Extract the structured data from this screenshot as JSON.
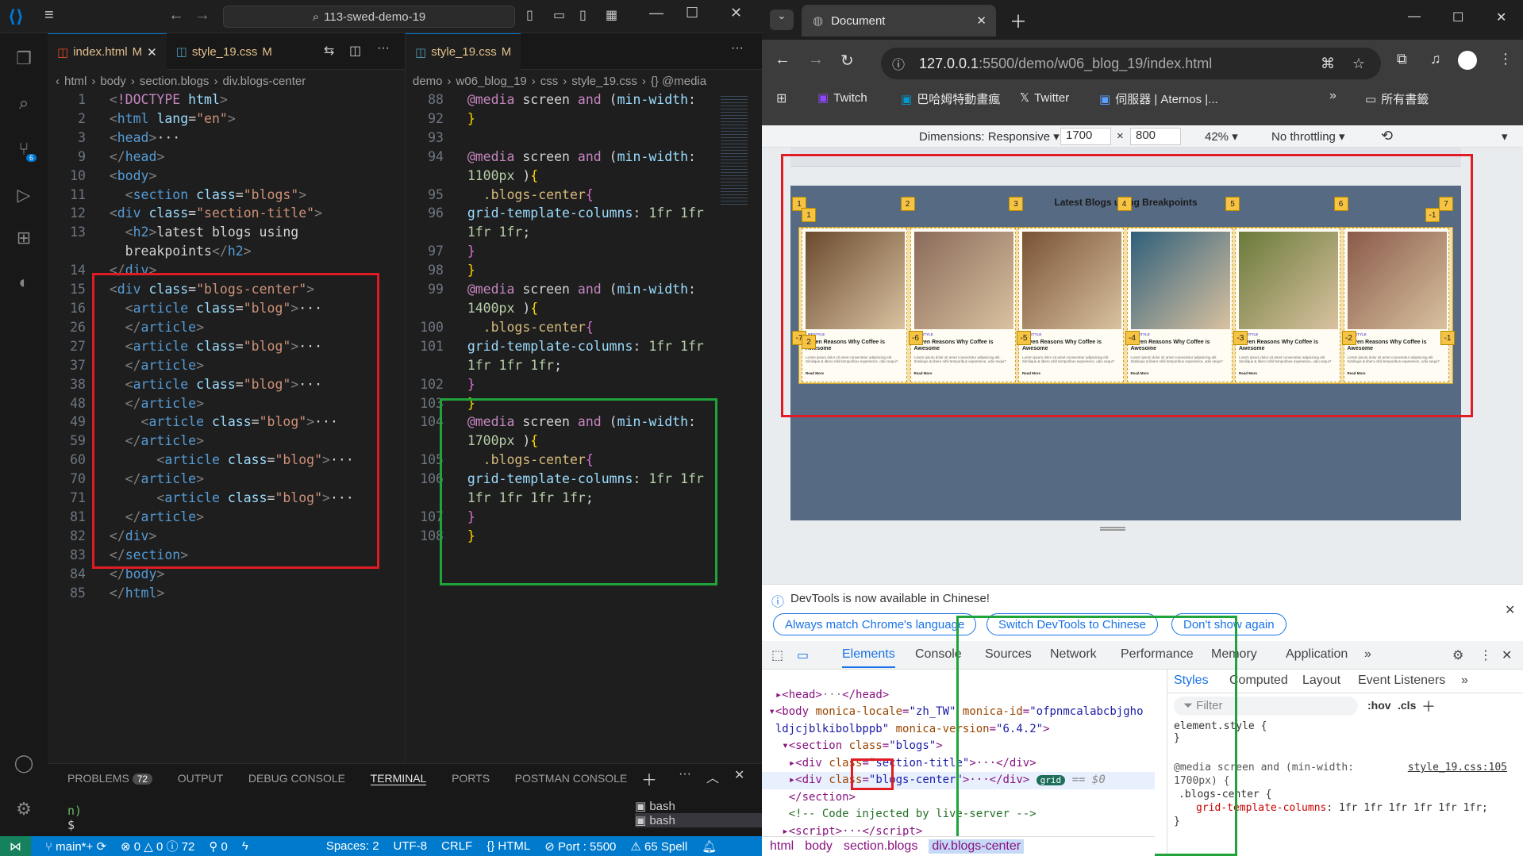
{
  "vscode": {
    "search": "113-swed-demo-19",
    "tab1": "index.html",
    "tab1_mod": "M",
    "tab2": "style_19.css",
    "tab2_mod": "M",
    "tab3": "style_19.css",
    "tab3_mod": "M",
    "crumbs_left": [
      "html",
      "body",
      "section.blogs",
      "div.blogs-center"
    ],
    "crumbs_right": [
      "demo",
      "w06_blog_19",
      "css",
      "style_19.css",
      "{} @media"
    ],
    "html_lines": [
      {
        "n": "1",
        "html": "<span class='t'>&lt;</span><span class='kw'>!DOCTYPE</span> <span class='at'>html</span><span class='t'>&gt;</span>"
      },
      {
        "n": "2",
        "html": "<span class='t'>&lt;</span><span class='tg'>html</span> <span class='at'>lang</span><span class='tx'>=</span><span class='sv'>\"en\"</span><span class='t'>&gt;</span>"
      },
      {
        "n": "3",
        "html": "<span class='t'>&lt;</span><span class='tg'>head</span><span class='t'>&gt;</span><span class='tx'>···</span>"
      },
      {
        "n": "9",
        "html": "<span class='t'>&lt;/</span><span class='tg'>head</span><span class='t'>&gt;</span>"
      },
      {
        "n": "10",
        "html": "<span class='t'>&lt;</span><span class='tg'>body</span><span class='t'>&gt;</span>"
      },
      {
        "n": "11",
        "html": "  <span class='t'>&lt;</span><span class='tg'>section</span> <span class='at'>class</span><span class='tx'>=</span><span class='sv'>\"blogs\"</span><span class='t'>&gt;</span>"
      },
      {
        "n": "12",
        "html": "<span class='t'>&lt;</span><span class='tg'>div</span> <span class='at'>class</span><span class='tx'>=</span><span class='sv'>\"section-title\"</span><span class='t'>&gt;</span>"
      },
      {
        "n": "13",
        "html": "  <span class='t'>&lt;</span><span class='tg'>h2</span><span class='t'>&gt;</span><span class='tx'>latest blogs using</span>"
      },
      {
        "n": "",
        "html": "  <span class='tx'>breakpoints</span><span class='t'>&lt;/</span><span class='tg'>h2</span><span class='t'>&gt;</span>"
      },
      {
        "n": "14",
        "html": "<span class='t'>&lt;/</span><span class='tg'>div</span><span class='t'>&gt;</span>"
      },
      {
        "n": "15",
        "html": "<span class='t'>&lt;</span><span class='tg'>div</span> <span class='at'>class</span><span class='tx'>=</span><span class='sv'>\"blogs-center\"</span><span class='t'>&gt;</span>"
      },
      {
        "n": "16",
        "html": "  <span class='t'>&lt;</span><span class='tg'>article</span> <span class='at'>class</span><span class='tx'>=</span><span class='sv'>\"blog\"</span><span class='t'>&gt;</span><span class='tx'>···</span>"
      },
      {
        "n": "26",
        "html": "  <span class='t'>&lt;/</span><span class='tg'>article</span><span class='t'>&gt;</span>"
      },
      {
        "n": "27",
        "html": "  <span class='t'>&lt;</span><span class='tg'>article</span> <span class='at'>class</span><span class='tx'>=</span><span class='sv'>\"blog\"</span><span class='t'>&gt;</span><span class='tx'>···</span>"
      },
      {
        "n": "37",
        "html": "  <span class='t'>&lt;/</span><span class='tg'>article</span><span class='t'>&gt;</span>"
      },
      {
        "n": "38",
        "html": "  <span class='t'>&lt;</span><span class='tg'>article</span> <span class='at'>class</span><span class='tx'>=</span><span class='sv'>\"blog\"</span><span class='t'>&gt;</span><span class='tx'>···</span>"
      },
      {
        "n": "48",
        "html": "  <span class='t'>&lt;/</span><span class='tg'>article</span><span class='t'>&gt;</span>"
      },
      {
        "n": "49",
        "html": "    <span class='t'>&lt;</span><span class='tg'>article</span> <span class='at'>class</span><span class='tx'>=</span><span class='sv'>\"blog\"</span><span class='t'>&gt;</span><span class='tx'>···</span>"
      },
      {
        "n": "59",
        "html": "  <span class='t'>&lt;/</span><span class='tg'>article</span><span class='t'>&gt;</span>"
      },
      {
        "n": "60",
        "html": "      <span class='t'>&lt;</span><span class='tg'>article</span> <span class='at'>class</span><span class='tx'>=</span><span class='sv'>\"blog\"</span><span class='t'>&gt;</span><span class='tx'>···</span>"
      },
      {
        "n": "70",
        "html": "  <span class='t'>&lt;/</span><span class='tg'>article</span><span class='t'>&gt;</span>"
      },
      {
        "n": "71",
        "html": "      <span class='t'>&lt;</span><span class='tg'>article</span> <span class='at'>class</span><span class='tx'>=</span><span class='sv'>\"blog\"</span><span class='t'>&gt;</span><span class='tx'>···</span>"
      },
      {
        "n": "81",
        "html": "  <span class='t'>&lt;/</span><span class='tg'>article</span><span class='t'>&gt;</span>"
      },
      {
        "n": "82",
        "html": "<span class='t'>&lt;/</span><span class='tg'>div</span><span class='t'>&gt;</span>"
      },
      {
        "n": "83",
        "html": "<span class='t'>&lt;/</span><span class='tg'>section</span><span class='t'>&gt;</span>"
      },
      {
        "n": "84",
        "html": "<span class='t'>&lt;/</span><span class='tg'>body</span><span class='t'>&gt;</span>"
      },
      {
        "n": "85",
        "html": "<span class='t'>&lt;/</span><span class='tg'>html</span><span class='t'>&gt;</span>"
      }
    ],
    "css_lines": [
      {
        "n": "88",
        "html": "<span class='kw'>@media</span> <span class='tx'>screen</span> <span class='kw'>and</span> <span class='tx'>(</span><span class='pr'>min-width</span><span class='tx'>:</span>"
      },
      {
        "n": "92",
        "html": "<span class='br'>}</span>"
      },
      {
        "n": "93",
        "html": ""
      },
      {
        "n": "94",
        "html": "<span class='kw'>@media</span> <span class='tx'>screen</span> <span class='kw'>and</span> <span class='tx'>(</span><span class='pr'>min-width</span><span class='tx'>:</span>"
      },
      {
        "n": "",
        "html": "<span class='nu'>1100px</span> <span class='tx'>)</span><span class='br'>{</span>"
      },
      {
        "n": "95",
        "html": "  <span class='cl'>.blogs-center</span><span class='br2'>{</span>"
      },
      {
        "n": "96",
        "html": "<span class='pr'>grid-template-columns</span><span class='tx'>: </span><span class='nu'>1fr 1fr</span>"
      },
      {
        "n": "",
        "html": "<span class='nu'>1fr 1fr</span><span class='tx'>;</span>"
      },
      {
        "n": "97",
        "html": "<span class='br2'>}</span>"
      },
      {
        "n": "98",
        "html": "<span class='br'>}</span>"
      },
      {
        "n": "99",
        "html": "<span class='kw'>@media</span> <span class='tx'>screen</span> <span class='kw'>and</span> <span class='tx'>(</span><span class='pr'>min-width</span><span class='tx'>:</span>"
      },
      {
        "n": "",
        "html": "<span class='nu'>1400px</span> <span class='tx'>)</span><span class='br'>{</span>"
      },
      {
        "n": "100",
        "html": "  <span class='cl'>.blogs-center</span><span class='br2'>{</span>"
      },
      {
        "n": "101",
        "html": "<span class='pr'>grid-template-columns</span><span class='tx'>: </span><span class='nu'>1fr 1fr</span>"
      },
      {
        "n": "",
        "html": "<span class='nu'>1fr 1fr 1fr</span><span class='tx'>;</span>"
      },
      {
        "n": "102",
        "html": "<span class='br2'>}</span>"
      },
      {
        "n": "103",
        "html": "<span class='br'>}</span>"
      },
      {
        "n": "104",
        "html": "<span class='kw'>@media</span> <span class='tx'>screen</span> <span class='kw'>and</span> <span class='tx'>(</span><span class='pr'>min-width</span><span class='tx'>:</span>"
      },
      {
        "n": "",
        "html": "<span class='nu'>1700px</span> <span class='tx'>)</span><span class='br'>{</span>"
      },
      {
        "n": "105",
        "html": "  <span class='cl'>.blogs-center</span><span class='br2'>{</span>"
      },
      {
        "n": "106",
        "html": "<span class='pr'>grid-template-columns</span><span class='tx'>: </span><span class='nu'>1fr 1fr</span>"
      },
      {
        "n": "",
        "html": "<span class='nu'>1fr 1fr 1fr 1fr</span><span class='tx'>;</span>"
      },
      {
        "n": "107",
        "html": "<span class='br2'>}</span>"
      },
      {
        "n": "108",
        "html": "<span class='br'>}</span>"
      }
    ],
    "panel_tabs": [
      "PROBLEMS",
      "OUTPUT",
      "DEBUG CONSOLE",
      "TERMINAL",
      "PORTS",
      "POSTMAN CONSOLE"
    ],
    "problems_count": "72",
    "terminal_line1": "n)",
    "terminal_line2": "$",
    "terminals": [
      "bash",
      "bash"
    ],
    "status": {
      "branch": "main*+",
      "errors": "0",
      "warnings": "0",
      "info": "72",
      "ports_count": "0",
      "spaces": "Spaces: 2",
      "encoding": "UTF-8",
      "eol": "CRLF",
      "lang": "HTML",
      "port": "Port : 5500",
      "spell": "65 Spell"
    }
  },
  "chrome": {
    "tab_title": "Document",
    "url_host": "127.0.0.1",
    "url_path": ":5500/demo/w06_blog_19/index.html",
    "bookmarks": [
      "Twitch",
      "巴哈姆特動畫瘋",
      "Twitter",
      "伺服器 | Aternos |..."
    ],
    "all_bookmarks": "所有書籤",
    "dims_label": "Dimensions: Responsive",
    "width": "1700",
    "height": "800",
    "zoom": "42%",
    "throttle": "No throttling",
    "page_title": "Latest Blogs using Breakpoints",
    "card_category": "LIFESTYLE",
    "card_title": "Seven Reasons Why Coffee is Awesome",
    "card_text": "Lorem ipsum dolor sit amet consectetur adipisicing elit. Similique & libero nihil temporibus experience, odio sequi?",
    "card_more": "Read More",
    "grid_top": [
      "1",
      "2",
      "3",
      "4",
      "5",
      "6",
      "7"
    ],
    "grid_bottom": [
      "-7",
      "-6",
      "-5",
      "-4",
      "-3",
      "-2",
      "-1"
    ],
    "grid_row_top": "1",
    "grid_row_bottom": "2",
    "grid_row_neg": "-1",
    "notice": "DevTools is now available in Chinese!",
    "notice_btns": [
      "Always match Chrome's language",
      "Switch DevTools to Chinese",
      "Don't show again"
    ],
    "devtools_tabs": [
      "Elements",
      "Console",
      "Sources",
      "Network",
      "Performance",
      "Memory",
      "Application"
    ],
    "style_tabs": [
      "Styles",
      "Computed",
      "Layout",
      "Event Listeners"
    ],
    "filter_placeholder": "Filter",
    "hov": ":hov",
    "cls": ".cls",
    "element_style": "element.style {",
    "media_rule": "@media screen and (min-width: 1700px) {",
    "rule_source": "style_19.css:105",
    "selector": ".blogs-center {",
    "prop": "grid-template-columns",
    "value": "1fr 1fr 1fr 1fr 1fr 1fr;",
    "grid_badge": "grid",
    "dollar0": "== $0",
    "breadcrumb": [
      "html",
      "body",
      "section.blogs",
      "div.blogs-center"
    ]
  }
}
